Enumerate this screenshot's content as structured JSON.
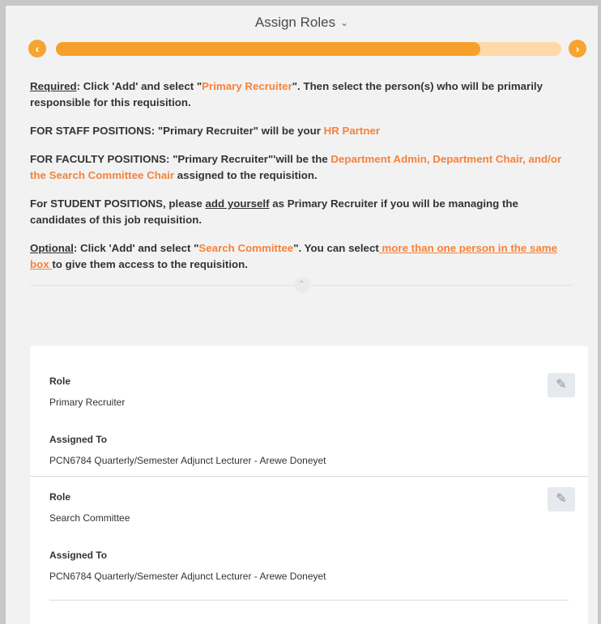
{
  "header": {
    "title": "Assign Roles",
    "chevron_icon": "chevron-down-icon"
  },
  "progress": {
    "fraction": 0.84,
    "prev_icon": "chevron-left-icon",
    "next_icon": "chevron-right-icon"
  },
  "instructions": {
    "p1": {
      "a": "Required",
      "b": ": Click 'Add' and select \"",
      "c": "Primary Recruiter",
      "d": "\". Then select the person(s) who will be primarily responsible for this requisition."
    },
    "p2": {
      "a": "FOR STAFF POSITIONS: \"Primary Recruiter\" will be your ",
      "b": "HR Partner"
    },
    "p3": {
      "a": "FOR FACULTY POSITIONS:  \"Primary Recruiter\"'will be the ",
      "b": "Department Admin, Department Chair, and/or the Search Committee Chair",
      "c": " assigned to the requisition."
    },
    "p4": {
      "a": "For STUDENT POSITIONS, please ",
      "b": "add yourself",
      "c": " as Primary Recruiter if you will be managing the candidates of this job requisition."
    },
    "p5": {
      "a": "Optional",
      "b": ": Click 'Add' and select \"",
      "c": "Search Committee",
      "d": "\". You can select",
      "e": " more than one person in the same box ",
      "f": "to give them access to the requisition."
    }
  },
  "assignments": [
    {
      "role_label": "Role",
      "role_value": "Primary Recruiter",
      "assigned_label": "Assigned To",
      "assigned_value": "PCN6784 Quarterly/Semester Adjunct Lecturer - Arewe Doneyet"
    },
    {
      "role_label": "Role",
      "role_value": "Search Committee",
      "assigned_label": "Assigned To",
      "assigned_value": "PCN6784 Quarterly/Semester Adjunct Lecturer - Arewe Doneyet"
    }
  ],
  "colors": {
    "accent": "#f6a02b",
    "accent_light": "#fdd9a8",
    "link": "#f5823b"
  }
}
